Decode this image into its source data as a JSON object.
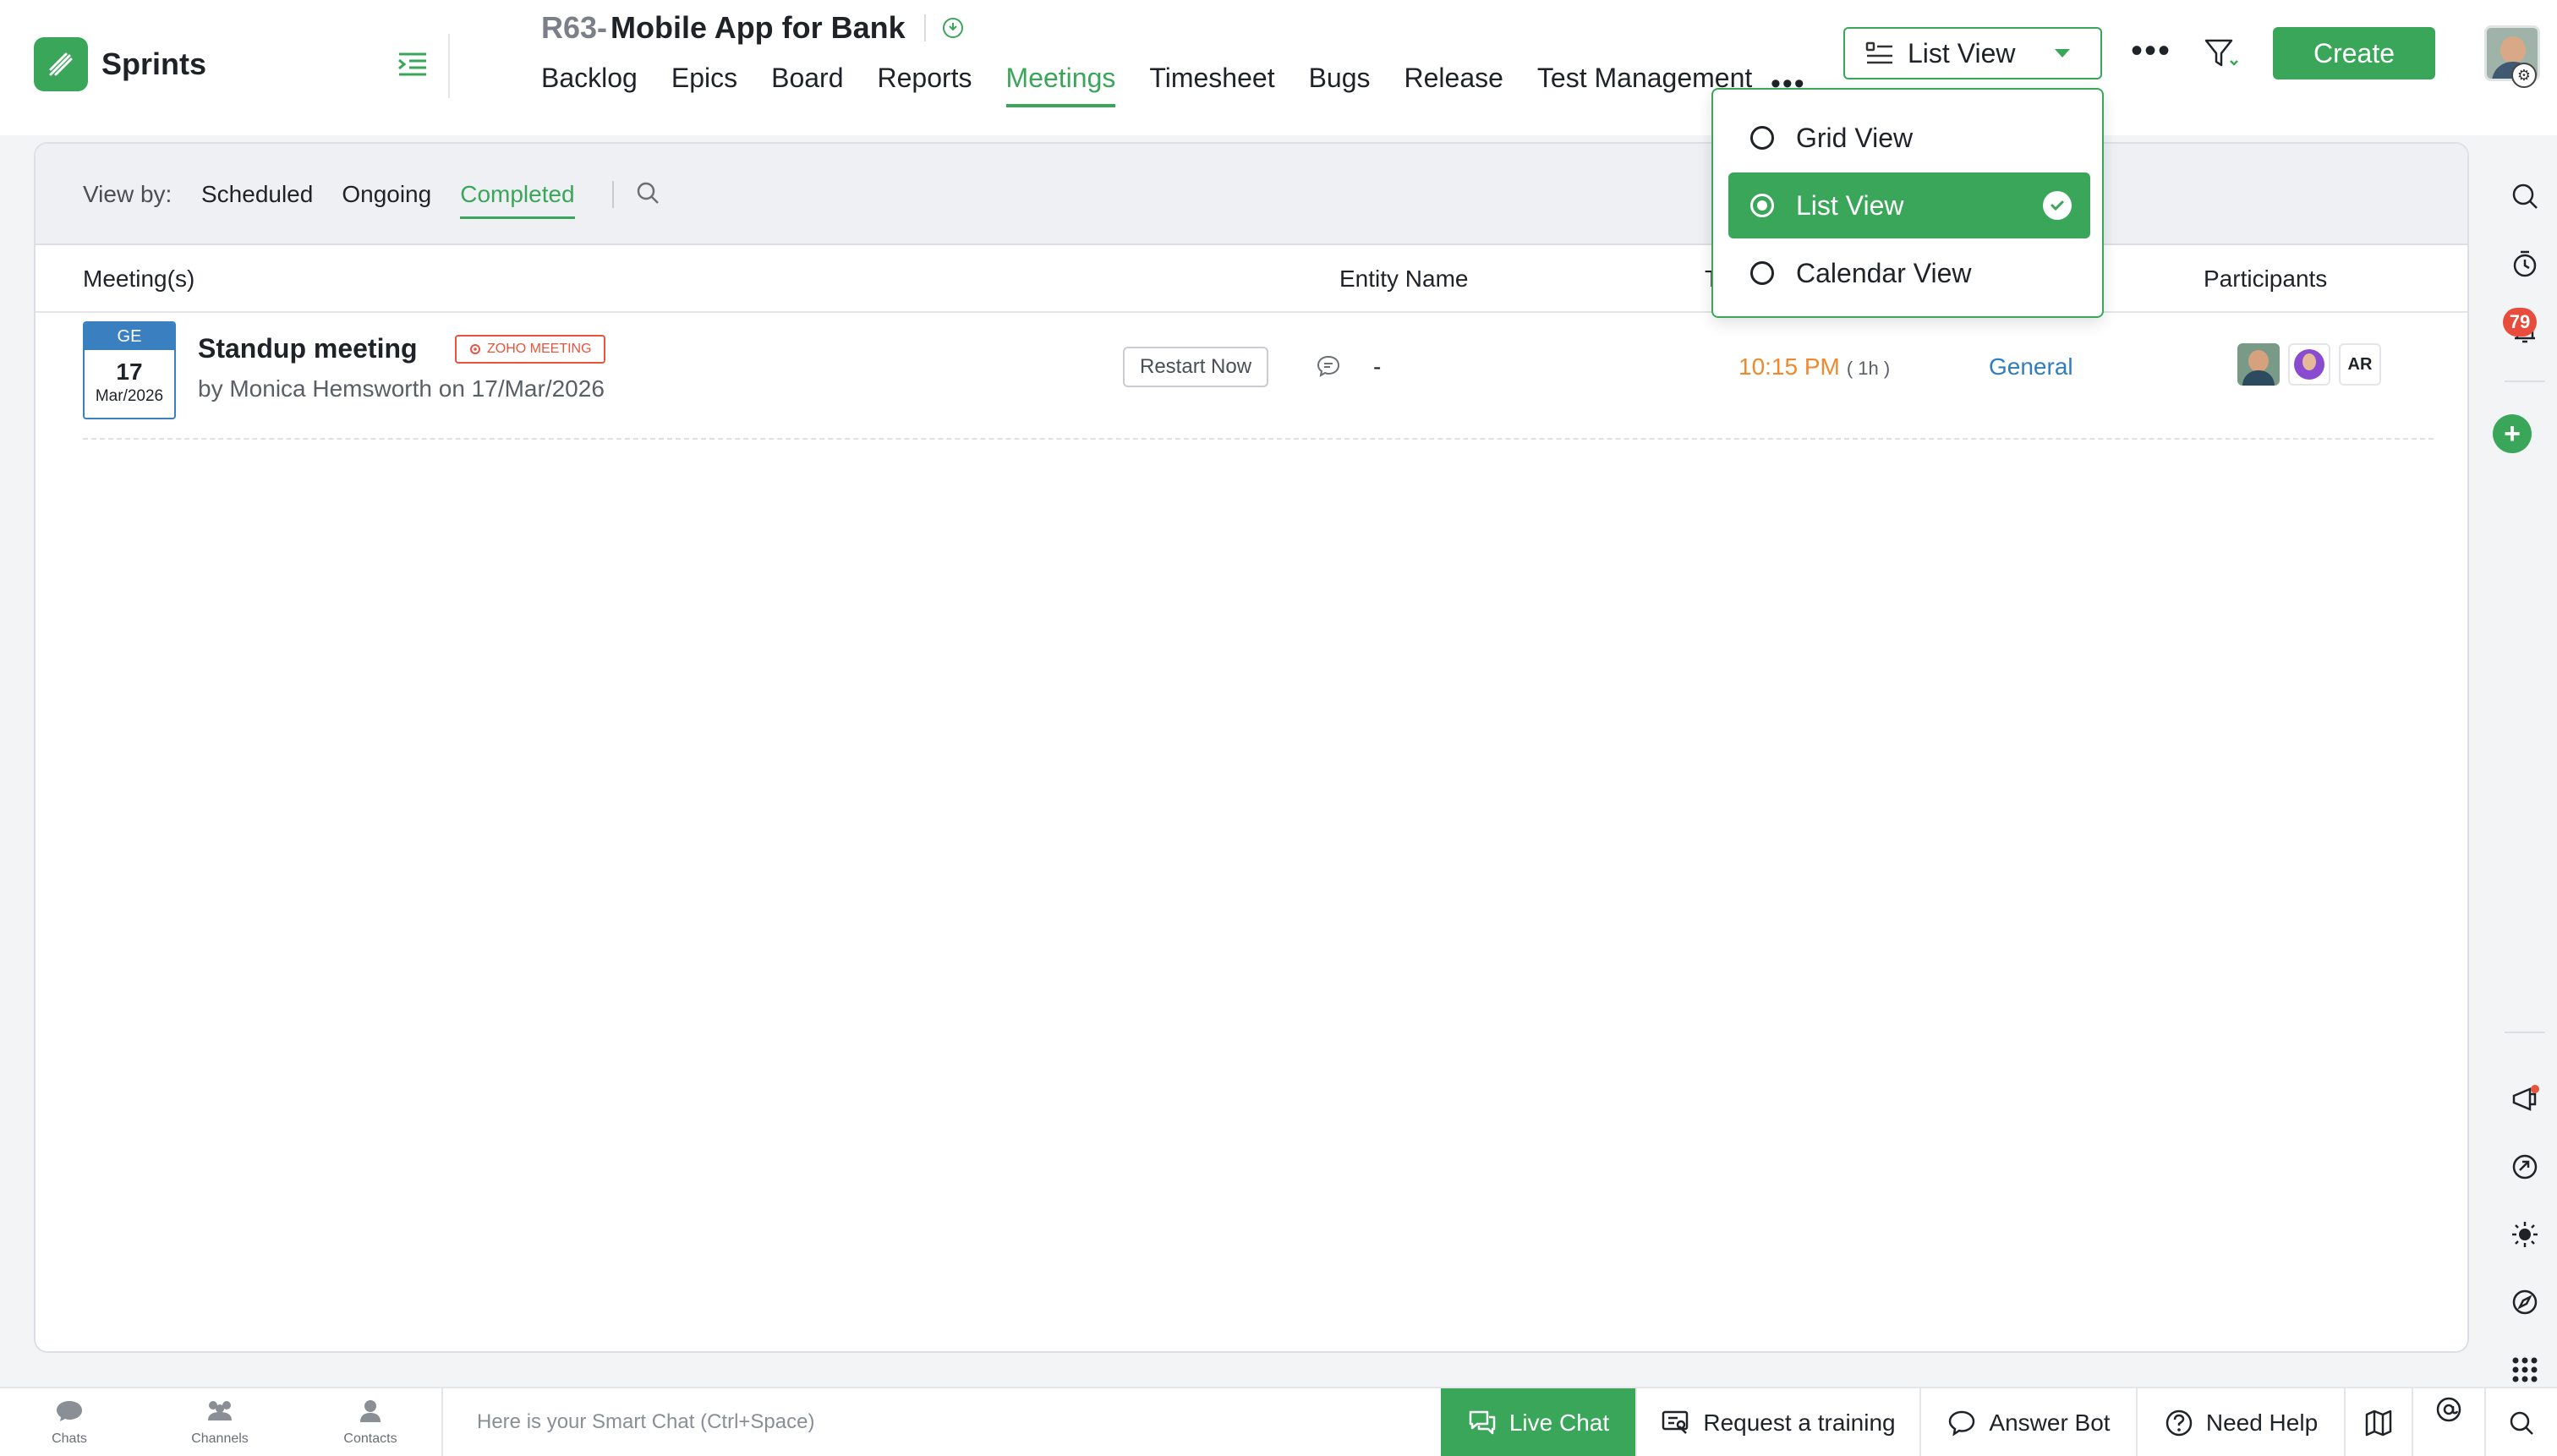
{
  "brand": {
    "name": "Sprints"
  },
  "project": {
    "key": "R63-",
    "name": "Mobile App for Bank"
  },
  "nav": {
    "items": [
      "Backlog",
      "Epics",
      "Board",
      "Reports",
      "Meetings",
      "Timesheet",
      "Bugs",
      "Release",
      "Test Management"
    ],
    "active": "Meetings",
    "more": "•••"
  },
  "toolbar": {
    "view_select": "List View",
    "more": "•••",
    "create_label": "Create"
  },
  "dropdown": {
    "options": [
      {
        "label": "Grid View",
        "selected": false
      },
      {
        "label": "List View",
        "selected": true
      },
      {
        "label": "Calendar View",
        "selected": false
      }
    ]
  },
  "viewbar": {
    "label": "View by:",
    "tabs": [
      "Scheduled",
      "Ongoing",
      "Completed"
    ],
    "active": "Completed"
  },
  "table": {
    "headers": {
      "meetings": "Meeting(s)",
      "entity": "Entity Name",
      "time": "T",
      "participants": "Participants"
    },
    "rows": [
      {
        "date_head": "GE",
        "date_day": "17",
        "date_month": "Mar/2026",
        "title": "Standup meeting",
        "badge": "ZOHO MEETING",
        "subtitle": "by Monica Hemsworth on 17/Mar/2026",
        "action": "Restart Now",
        "entity": "-",
        "time": "10:15 PM",
        "duration": "( 1h )",
        "type": "General",
        "participant_initials": "AR"
      }
    ]
  },
  "rail": {
    "notification_count": "79"
  },
  "bottombar": {
    "tabs": [
      "Chats",
      "Channels",
      "Contacts"
    ],
    "smart_chat_placeholder": "Here is your Smart Chat (Ctrl+Space)",
    "live_chat": "Live Chat",
    "request_training": "Request a training",
    "answer_bot": "Answer Bot",
    "need_help": "Need Help"
  },
  "colors": {
    "accent": "#3aa65a",
    "time": "#f0892e",
    "link": "#2f7dc1",
    "badge": "#e8553e",
    "notification": "#e74c3c"
  }
}
